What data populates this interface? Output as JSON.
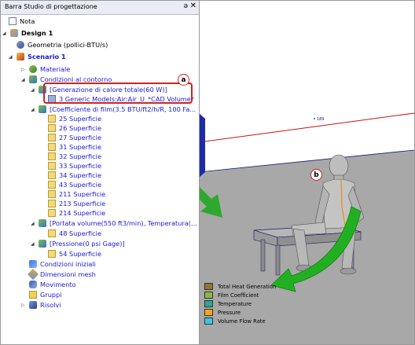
{
  "panel": {
    "title": "Barra Studio di progettazione",
    "pin_glyph": "ə",
    "close_glyph": "✕"
  },
  "tree": {
    "nota": "Nota",
    "design": "Design 1",
    "geometria": "Geometria (pollici-BTU/s)",
    "scenario": "Scenario 1",
    "materiale": "Materiale",
    "condizioni_contorno": "Condizioni al contorno",
    "generazione_calore": "[Generazione di calore totale(60 W)]",
    "generic_models": "3 Generic Models:Air:Air_U_*CAD Volume*",
    "coefficiente_film": "[Coefficiente di film(3.5 BTU/ft2/h/R, 100 Fa...",
    "surfaces_film": [
      "25 Superficie",
      "26 Superficie",
      "27 Superficie",
      "31 Superficie",
      "32 Superficie",
      "33 Superficie",
      "34 Superficie",
      "43 Superficie",
      "211 Superficie",
      "213 Superficie",
      "214 Superficie"
    ],
    "portata_volume": "[Portata volume(550 ft3/min), Temperatura(...",
    "surface_portata": "48 Superficie",
    "pressione": "[Pressione(0 psi Gage)]",
    "surface_pressione": "54 Superficie",
    "condizioni_iniziali": "Condizioni iniziali",
    "dimensioni_mesh": "Dimensioni mesh",
    "movimento": "Movimento",
    "gruppi": "Gruppi",
    "risolvi": "Risolvi"
  },
  "callouts": {
    "a": "a",
    "b": "b"
  },
  "viewport": {
    "dimension_label": "189"
  },
  "legend": [
    {
      "label": "Total Heat Generation",
      "color": "#8a7a2e"
    },
    {
      "label": "Film Coefficient",
      "color": "#8bb84a"
    },
    {
      "label": "Temperature",
      "color": "#2ba896"
    },
    {
      "label": "Pressure",
      "color": "#f2a81c"
    },
    {
      "label": "Volume Flow Rate",
      "color": "#3ec6e0"
    }
  ]
}
